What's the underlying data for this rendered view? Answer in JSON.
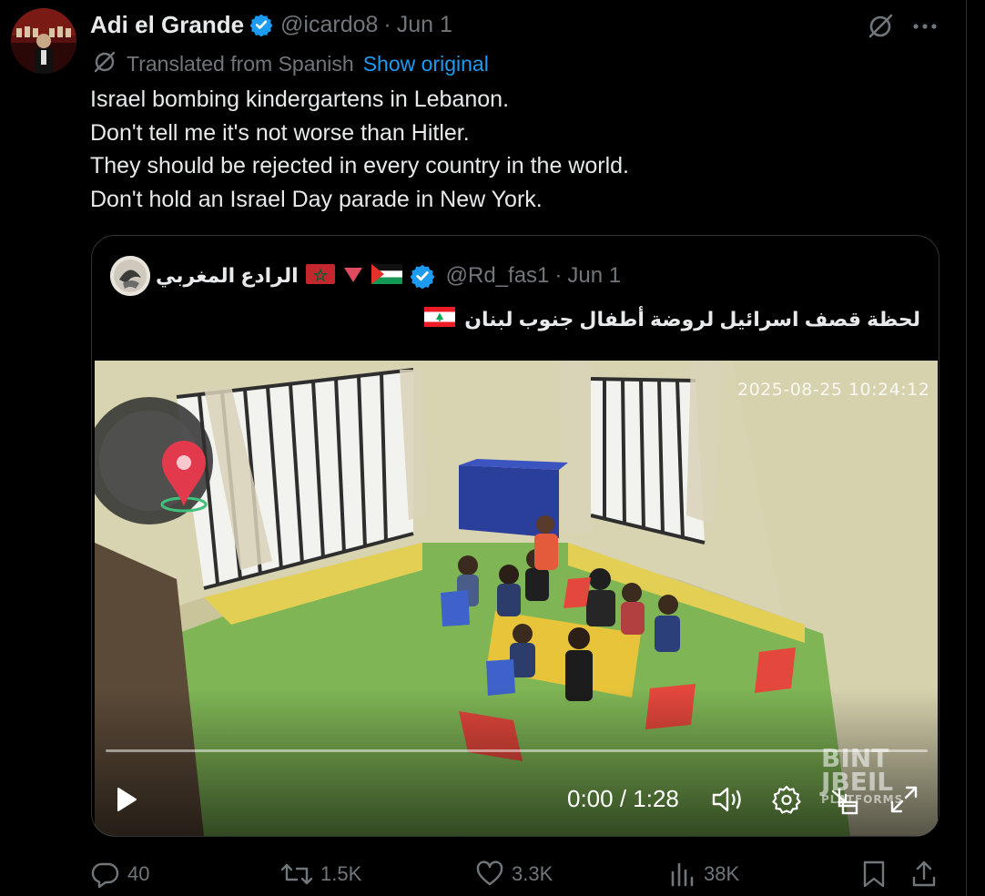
{
  "tweet": {
    "author": {
      "display_name": "Adi el Grande",
      "handle": "@icardo8",
      "date": "Jun 1",
      "verified": true
    },
    "translated_label": "Translated from Spanish",
    "show_original_label": "Show original",
    "text_lines": [
      "Israel bombing kindergartens in Lebanon.",
      "Don't tell me it's not worse than Hitler.",
      "They should be rejected in every country in the world.",
      "Don't hold an Israel Day parade in New York."
    ],
    "icons": {
      "grok": "translate-slash-icon",
      "more": "more-dots-icon"
    }
  },
  "quote": {
    "display_name": "الرادع المغربي",
    "flags": [
      "morocco-flag-icon",
      "red-triangle-icon",
      "palestine-flag-icon"
    ],
    "verified": true,
    "handle": "@Rd_fas1",
    "date": "Jun 1",
    "text": "لحظة قصف اسرائيل لروضة أطفال جنوب لبنان",
    "text_flag": "lebanon-flag-icon",
    "video": {
      "timestamp_overlay": "2025-08-25 10:24:12",
      "watermark_main": "BINT\nJBEIL",
      "watermark_sub": "PLATFORMS",
      "current_time": "0:00",
      "duration": "1:28",
      "time_display": "0:00 / 1:28",
      "progress": 0.0,
      "controls": [
        "play-icon",
        "volume-icon",
        "settings-gear-icon",
        "minimize-icon",
        "fullscreen-icon"
      ]
    }
  },
  "actions": {
    "replies": "40",
    "reposts": "1.5K",
    "likes": "3.3K",
    "views": "38K"
  },
  "colors": {
    "background": "#000000",
    "text_primary": "#e7e9ea",
    "text_secondary": "#71767b",
    "accent": "#1d9bf0",
    "border": "#2f3336"
  }
}
